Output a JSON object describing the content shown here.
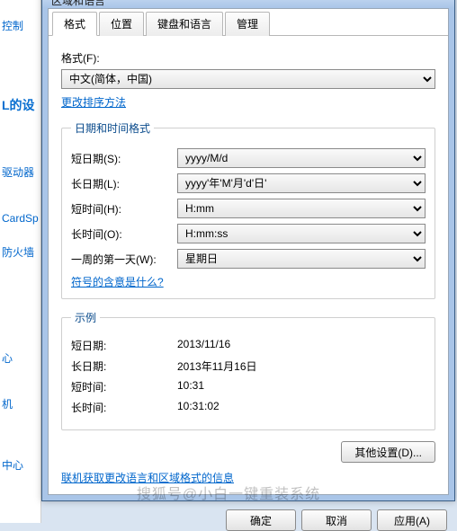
{
  "bgLeft": {
    "back": "控制",
    "heading": "L的设",
    "items": [
      "驱动器",
      "CardSp",
      "防火墙",
      "心",
      "机",
      "中心"
    ]
  },
  "window": {
    "title": "区域和语言"
  },
  "tabs": [
    "格式",
    "位置",
    "键盘和语言",
    "管理"
  ],
  "format": {
    "label": "格式(F):",
    "value": "中文(简体，中国)",
    "changeSort": "更改排序方法"
  },
  "dt": {
    "legend": "日期和时间格式",
    "shortDateLabel": "短日期(S):",
    "shortDateValue": "yyyy/M/d",
    "longDateLabel": "长日期(L):",
    "longDateValue": "yyyy'年'M'月'd'日'",
    "shortTimeLabel": "短时间(H):",
    "shortTimeValue": "H:mm",
    "longTimeLabel": "长时间(O):",
    "longTimeValue": "H:mm:ss",
    "firstDowLabel": "一周的第一天(W):",
    "firstDowValue": "星期日",
    "symbolMeaning": "符号的含意是什么?"
  },
  "example": {
    "legend": "示例",
    "shortDateLabel": "短日期:",
    "shortDateValue": "2013/11/16",
    "longDateLabel": "长日期:",
    "longDateValue": "2013年11月16日",
    "shortTimeLabel": "短时间:",
    "shortTimeValue": "10:31",
    "longTimeLabel": "长时间:",
    "longTimeValue": "10:31:02"
  },
  "otherSettings": "其他设置(D)...",
  "onlineLink": "联机获取更改语言和区域格式的信息",
  "buttons": {
    "ok": "确定",
    "cancel": "取消",
    "apply": "应用(A)"
  },
  "watermark": "搜狐号@小白一键重装系统"
}
